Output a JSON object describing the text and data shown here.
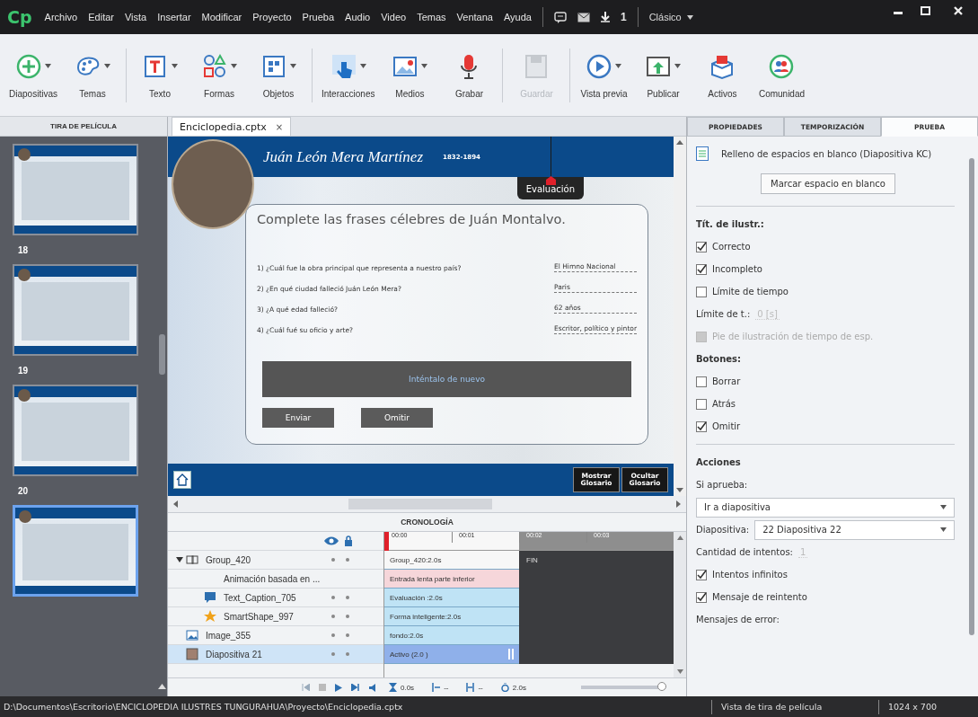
{
  "title_bar": {
    "logo": "Cp",
    "menu": [
      "Archivo",
      "Editar",
      "Vista",
      "Insertar",
      "Modificar",
      "Proyecto",
      "Prueba",
      "Audio",
      "Video",
      "Temas",
      "Ventana",
      "Ayuda"
    ],
    "notification_count": "1",
    "workspace": "Clásico"
  },
  "toolbar": {
    "groups": [
      [
        {
          "label": "Diapositivas",
          "dropdown": true,
          "disabled": false
        },
        {
          "label": "Temas",
          "dropdown": true,
          "disabled": false
        }
      ],
      [
        {
          "label": "Texto",
          "dropdown": true,
          "disabled": false
        },
        {
          "label": "Formas",
          "dropdown": true,
          "disabled": false
        },
        {
          "label": "Objetos",
          "dropdown": true,
          "disabled": false
        }
      ],
      [
        {
          "label": "Interacciones",
          "dropdown": true,
          "disabled": false
        },
        {
          "label": "Medios",
          "dropdown": true,
          "disabled": false
        },
        {
          "label": "Grabar",
          "dropdown": false,
          "disabled": false
        }
      ],
      [
        {
          "label": "Guardar",
          "dropdown": false,
          "disabled": true
        }
      ],
      [
        {
          "label": "Vista previa",
          "dropdown": true,
          "disabled": false
        },
        {
          "label": "Publicar",
          "dropdown": true,
          "disabled": false
        },
        {
          "label": "Activos",
          "dropdown": false,
          "disabled": false
        },
        {
          "label": "Comunidad",
          "dropdown": false,
          "disabled": false
        }
      ]
    ]
  },
  "filmstrip": {
    "title": "TIRA DE PELÍCULA",
    "slides": [
      {
        "number": "18",
        "selected": false
      },
      {
        "number": "19",
        "selected": false
      },
      {
        "number": "20",
        "selected": false
      },
      {
        "selected": true
      }
    ]
  },
  "document": {
    "tab": "Enciclopedia.cptx",
    "close": "×"
  },
  "slide": {
    "title": "Juán León Mera Martínez",
    "years": "1832-1894",
    "tab": "Evaluación",
    "heading": "Complete las frases célebres de Juán Montalvo.",
    "questions": [
      {
        "text": "1) ¿Cuál fue la obra principal que representa a nuestro país?",
        "answer": "El Himno Nacional"
      },
      {
        "text": "2) ¿En qué ciudad falleció Juán León Mera?",
        "answer": "Paris"
      },
      {
        "text": "3) ¿A qué edad falleció?",
        "answer": "62 años"
      },
      {
        "text": "4) ¿Cuál fué su oficio y arte?",
        "answer": "Escritor, político y pintor"
      }
    ],
    "feedback": "Inténtalo de nuevo",
    "buttons": [
      "Enviar",
      "Omitir"
    ],
    "footer_buttons": [
      "Mostrar Glosario",
      "Ocultar Glosario"
    ]
  },
  "timeline": {
    "title": "CRONOLOGÍA",
    "ruler": [
      "00:00",
      "00:01",
      "00:02",
      "00:03"
    ],
    "end_label": "FIN",
    "layers": [
      {
        "kind": "group",
        "name": "Group_420",
        "bar": "Group_420:2.0s",
        "expanded": true,
        "selected": false,
        "children": [
          {
            "kind": "effect",
            "name": "Animación basada en ...",
            "bar": "Entrada lenta parte inferior",
            "selected": false
          },
          {
            "kind": "caption",
            "name": "Text_Caption_705",
            "bar": "Evaluación :2.0s",
            "selected": false
          },
          {
            "kind": "shape",
            "name": "SmartShape_997",
            "bar": "Forma inteligente:2.0s",
            "selected": false
          }
        ]
      },
      {
        "kind": "image",
        "name": "Image_355",
        "bar": "fondo:2.0s",
        "selected": false
      },
      {
        "kind": "slide",
        "name": "Diapositiva 21",
        "bar": "Activo (2.0 )",
        "selected": true
      }
    ],
    "controls": {
      "start_time": "0.0s",
      "fade_in": "--",
      "fade_out": "--",
      "duration": "2.0s",
      "zoom": {
        "level": 1
      }
    }
  },
  "properties": {
    "tabs": [
      {
        "label": "PROPIEDADES",
        "selected": false
      },
      {
        "label": "TEMPORIZACIÓN",
        "selected": false
      },
      {
        "label": "PRUEBA",
        "selected": true
      }
    ],
    "items": [
      {
        "kind": "title",
        "text": "Relleno de espacios en blanco (Diapositiva KC)"
      },
      {
        "kind": "button",
        "text": "Marcar espacio en blanco"
      },
      {
        "kind": "divider"
      },
      {
        "kind": "heading",
        "text": "Tít. de ilustr.:"
      },
      {
        "kind": "checkbox",
        "text": "Correcto",
        "checked": true,
        "disabled": false
      },
      {
        "kind": "checkbox",
        "text": "Incompleto",
        "checked": true,
        "disabled": false
      },
      {
        "kind": "checkbox",
        "text": "Límite de tiempo",
        "checked": false,
        "disabled": false
      },
      {
        "kind": "field",
        "label": "Límite de t.:",
        "value": "0 [s]",
        "disabled": true
      },
      {
        "kind": "checkbox",
        "text": "Pie de ilustración de tiempo de esp.",
        "checked": false,
        "disabled": true
      },
      {
        "kind": "heading",
        "text": "Botones:"
      },
      {
        "kind": "checkbox",
        "text": "Borrar",
        "checked": false,
        "disabled": false
      },
      {
        "kind": "checkbox",
        "text": "Atrás",
        "checked": false,
        "disabled": false
      },
      {
        "kind": "checkbox",
        "text": "Omitir",
        "checked": true,
        "disabled": false
      },
      {
        "kind": "divider"
      },
      {
        "kind": "heading",
        "text": "Acciones"
      },
      {
        "kind": "label",
        "text": "Si aprueba:"
      },
      {
        "kind": "select",
        "value": "Ir a diapositiva"
      },
      {
        "kind": "select",
        "label": "Diapositiva:",
        "value": "22 Diapositiva 22"
      },
      {
        "kind": "field",
        "label": "Cantidad de intentos:",
        "value": "1",
        "disabled": true
      },
      {
        "kind": "checkbox",
        "text": "Intentos infinitos",
        "checked": true,
        "disabled": false
      },
      {
        "kind": "checkbox",
        "text": "Mensaje de reintento",
        "checked": true,
        "disabled": false
      },
      {
        "kind": "label",
        "text": "Mensajes de error:"
      }
    ]
  },
  "status_bar": {
    "path": "D:\\Documentos\\Escritorio\\ENCICLOPEDIA ILUSTRES TUNGURAHUA\\Proyecto\\Enciclopedia.cptx",
    "view": "Vista de tira de película",
    "resolution": "1024 x 700"
  }
}
